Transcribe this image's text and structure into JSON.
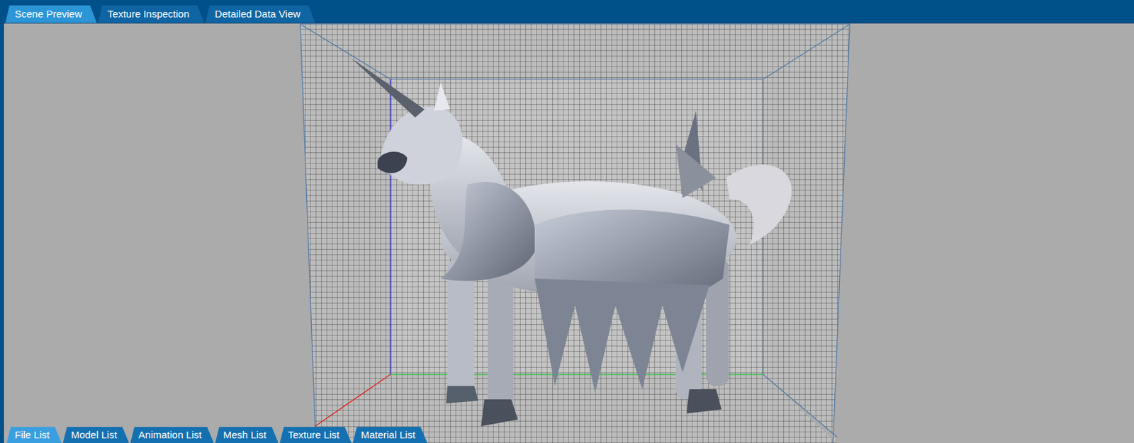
{
  "top_tabs": [
    {
      "label": "Scene Preview",
      "selected": true
    },
    {
      "label": "Texture Inspection",
      "selected": false
    },
    {
      "label": "Detailed Data View",
      "selected": false
    }
  ],
  "bottom_tabs": [
    {
      "label": "File List",
      "selected": true
    },
    {
      "label": "Model List",
      "selected": false
    },
    {
      "label": "Animation List",
      "selected": false
    },
    {
      "label": "Mesh List",
      "selected": false
    },
    {
      "label": "Texture List",
      "selected": false
    },
    {
      "label": "Material List",
      "selected": false
    }
  ]
}
